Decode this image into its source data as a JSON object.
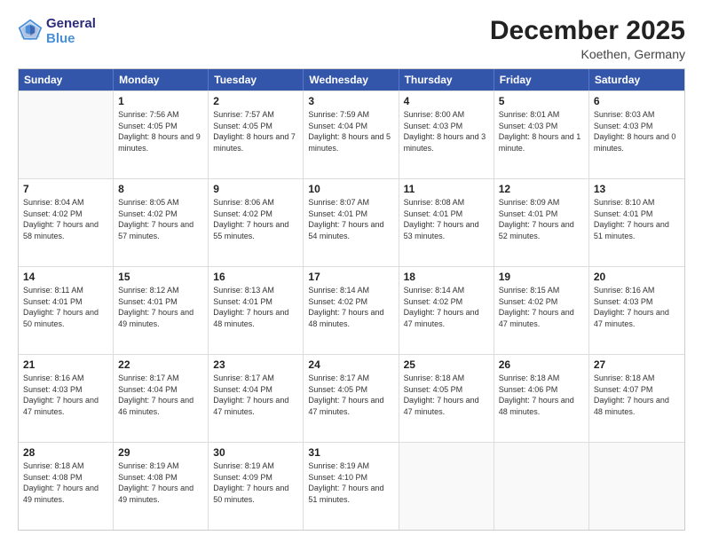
{
  "logo": {
    "line1": "General",
    "line2": "Blue"
  },
  "title": "December 2025",
  "subtitle": "Koethen, Germany",
  "days_of_week": [
    "Sunday",
    "Monday",
    "Tuesday",
    "Wednesday",
    "Thursday",
    "Friday",
    "Saturday"
  ],
  "weeks": [
    [
      {
        "day": "",
        "empty": true
      },
      {
        "day": "1",
        "sunrise": "7:56 AM",
        "sunset": "4:05 PM",
        "daylight": "8 hours and 9 minutes."
      },
      {
        "day": "2",
        "sunrise": "7:57 AM",
        "sunset": "4:05 PM",
        "daylight": "8 hours and 7 minutes."
      },
      {
        "day": "3",
        "sunrise": "7:59 AM",
        "sunset": "4:04 PM",
        "daylight": "8 hours and 5 minutes."
      },
      {
        "day": "4",
        "sunrise": "8:00 AM",
        "sunset": "4:03 PM",
        "daylight": "8 hours and 3 minutes."
      },
      {
        "day": "5",
        "sunrise": "8:01 AM",
        "sunset": "4:03 PM",
        "daylight": "8 hours and 1 minute."
      },
      {
        "day": "6",
        "sunrise": "8:03 AM",
        "sunset": "4:03 PM",
        "daylight": "8 hours and 0 minutes."
      }
    ],
    [
      {
        "day": "7",
        "sunrise": "8:04 AM",
        "sunset": "4:02 PM",
        "daylight": "7 hours and 58 minutes."
      },
      {
        "day": "8",
        "sunrise": "8:05 AM",
        "sunset": "4:02 PM",
        "daylight": "7 hours and 57 minutes."
      },
      {
        "day": "9",
        "sunrise": "8:06 AM",
        "sunset": "4:02 PM",
        "daylight": "7 hours and 55 minutes."
      },
      {
        "day": "10",
        "sunrise": "8:07 AM",
        "sunset": "4:01 PM",
        "daylight": "7 hours and 54 minutes."
      },
      {
        "day": "11",
        "sunrise": "8:08 AM",
        "sunset": "4:01 PM",
        "daylight": "7 hours and 53 minutes."
      },
      {
        "day": "12",
        "sunrise": "8:09 AM",
        "sunset": "4:01 PM",
        "daylight": "7 hours and 52 minutes."
      },
      {
        "day": "13",
        "sunrise": "8:10 AM",
        "sunset": "4:01 PM",
        "daylight": "7 hours and 51 minutes."
      }
    ],
    [
      {
        "day": "14",
        "sunrise": "8:11 AM",
        "sunset": "4:01 PM",
        "daylight": "7 hours and 50 minutes."
      },
      {
        "day": "15",
        "sunrise": "8:12 AM",
        "sunset": "4:01 PM",
        "daylight": "7 hours and 49 minutes."
      },
      {
        "day": "16",
        "sunrise": "8:13 AM",
        "sunset": "4:01 PM",
        "daylight": "7 hours and 48 minutes."
      },
      {
        "day": "17",
        "sunrise": "8:14 AM",
        "sunset": "4:02 PM",
        "daylight": "7 hours and 48 minutes."
      },
      {
        "day": "18",
        "sunrise": "8:14 AM",
        "sunset": "4:02 PM",
        "daylight": "7 hours and 47 minutes."
      },
      {
        "day": "19",
        "sunrise": "8:15 AM",
        "sunset": "4:02 PM",
        "daylight": "7 hours and 47 minutes."
      },
      {
        "day": "20",
        "sunrise": "8:16 AM",
        "sunset": "4:03 PM",
        "daylight": "7 hours and 47 minutes."
      }
    ],
    [
      {
        "day": "21",
        "sunrise": "8:16 AM",
        "sunset": "4:03 PM",
        "daylight": "7 hours and 47 minutes."
      },
      {
        "day": "22",
        "sunrise": "8:17 AM",
        "sunset": "4:04 PM",
        "daylight": "7 hours and 46 minutes."
      },
      {
        "day": "23",
        "sunrise": "8:17 AM",
        "sunset": "4:04 PM",
        "daylight": "7 hours and 47 minutes."
      },
      {
        "day": "24",
        "sunrise": "8:17 AM",
        "sunset": "4:05 PM",
        "daylight": "7 hours and 47 minutes."
      },
      {
        "day": "25",
        "sunrise": "8:18 AM",
        "sunset": "4:05 PM",
        "daylight": "7 hours and 47 minutes."
      },
      {
        "day": "26",
        "sunrise": "8:18 AM",
        "sunset": "4:06 PM",
        "daylight": "7 hours and 48 minutes."
      },
      {
        "day": "27",
        "sunrise": "8:18 AM",
        "sunset": "4:07 PM",
        "daylight": "7 hours and 48 minutes."
      }
    ],
    [
      {
        "day": "28",
        "sunrise": "8:18 AM",
        "sunset": "4:08 PM",
        "daylight": "7 hours and 49 minutes."
      },
      {
        "day": "29",
        "sunrise": "8:19 AM",
        "sunset": "4:08 PM",
        "daylight": "7 hours and 49 minutes."
      },
      {
        "day": "30",
        "sunrise": "8:19 AM",
        "sunset": "4:09 PM",
        "daylight": "7 hours and 50 minutes."
      },
      {
        "day": "31",
        "sunrise": "8:19 AM",
        "sunset": "4:10 PM",
        "daylight": "7 hours and 51 minutes."
      },
      {
        "day": "",
        "empty": true
      },
      {
        "day": "",
        "empty": true
      },
      {
        "day": "",
        "empty": true
      }
    ]
  ],
  "labels": {
    "sunrise": "Sunrise:",
    "sunset": "Sunset:",
    "daylight": "Daylight:"
  }
}
